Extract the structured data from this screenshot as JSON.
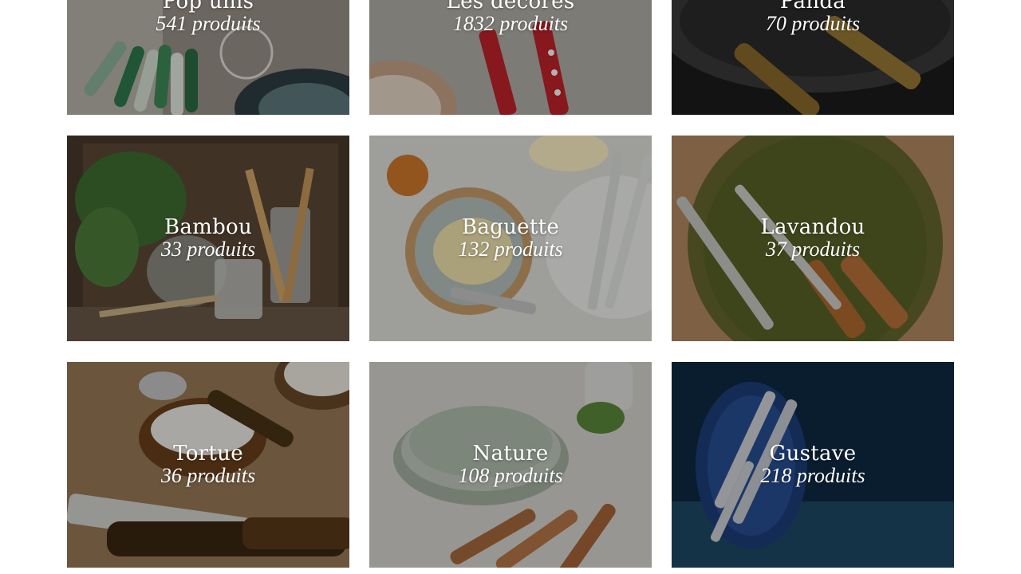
{
  "collections": [
    {
      "name": "Pop unis",
      "count": "541 produits"
    },
    {
      "name": "Les décorés",
      "count": "1832 produits"
    },
    {
      "name": "Panda",
      "count": "70 produits"
    },
    {
      "name": "Bambou",
      "count": "33 produits"
    },
    {
      "name": "Baguette",
      "count": "132 produits"
    },
    {
      "name": "Lavandou",
      "count": "37 produits"
    },
    {
      "name": "Tortue",
      "count": "36 produits"
    },
    {
      "name": "Nature",
      "count": "108 produits"
    },
    {
      "name": "Gustave",
      "count": "218 produits"
    }
  ]
}
